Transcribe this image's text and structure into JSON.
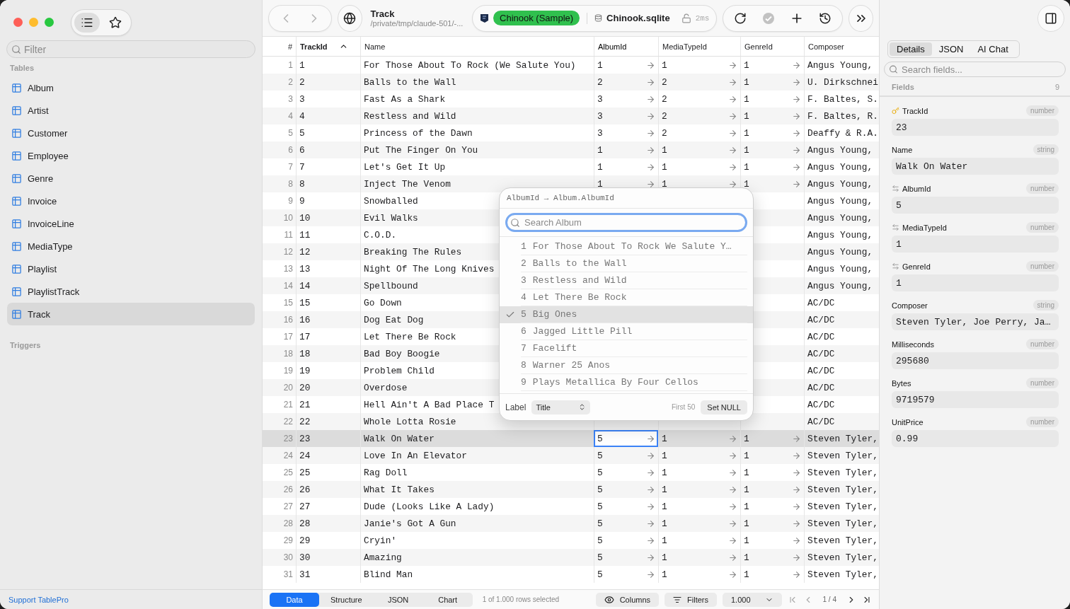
{
  "sidebar": {
    "filter": {
      "placeholder": "Filter"
    },
    "sections": [
      {
        "title": "Tables",
        "items": [
          {
            "label": "Album",
            "selected": false
          },
          {
            "label": "Artist",
            "selected": false
          },
          {
            "label": "Customer",
            "selected": false
          },
          {
            "label": "Employee",
            "selected": false
          },
          {
            "label": "Genre",
            "selected": false
          },
          {
            "label": "Invoice",
            "selected": false
          },
          {
            "label": "InvoiceLine",
            "selected": false
          },
          {
            "label": "MediaType",
            "selected": false
          },
          {
            "label": "Playlist",
            "selected": false
          },
          {
            "label": "PlaylistTrack",
            "selected": false
          },
          {
            "label": "Track",
            "selected": true
          }
        ]
      },
      {
        "title": "Triggers"
      }
    ],
    "footer_link": "Support TablePro",
    "view_toggle": [
      {
        "kind": "list",
        "selected": true
      },
      {
        "kind": "favorites",
        "selected": false
      }
    ]
  },
  "toolbar": {
    "title": "Track",
    "subtitle": "/private/tmp/claude-501/-...",
    "connection": {
      "name": "Chinook (Sample)",
      "color": "#30c04e",
      "database": "Chinook.sqlite",
      "latency": "2ms"
    }
  },
  "table": {
    "columns": [
      {
        "label": "#",
        "sorted": false,
        "foreign_key": false,
        "focused": false
      },
      {
        "label": "TrackId",
        "sorted": true,
        "foreign_key": false,
        "focused": false
      },
      {
        "label": "Name",
        "sorted": false,
        "foreign_key": false,
        "focused": false
      },
      {
        "label": "AlbumId",
        "sorted": false,
        "foreign_key": true,
        "focused": true
      },
      {
        "label": "MediaTypeId",
        "sorted": false,
        "foreign_key": true,
        "focused": false
      },
      {
        "label": "GenreId",
        "sorted": false,
        "foreign_key": true,
        "focused": false
      },
      {
        "label": "Composer",
        "sorted": false,
        "foreign_key": false,
        "focused": false
      }
    ],
    "rows": [
      {
        "cells": [
          "1",
          "1",
          "For Those About To Rock (We Salute You)",
          "1",
          "1",
          "1",
          "Angus Young,"
        ],
        "selected": false
      },
      {
        "cells": [
          "2",
          "2",
          "Balls to the Wall",
          "2",
          "2",
          "1",
          "U. Dirkschnei"
        ],
        "selected": false
      },
      {
        "cells": [
          "3",
          "3",
          "Fast As a Shark",
          "3",
          "2",
          "1",
          "F. Baltes, S."
        ],
        "selected": false
      },
      {
        "cells": [
          "4",
          "4",
          "Restless and Wild",
          "3",
          "2",
          "1",
          "F. Baltes, R."
        ],
        "selected": false
      },
      {
        "cells": [
          "5",
          "5",
          "Princess of the Dawn",
          "3",
          "2",
          "1",
          "Deaffy & R.A."
        ],
        "selected": false
      },
      {
        "cells": [
          "6",
          "6",
          "Put The Finger On You",
          "1",
          "1",
          "1",
          "Angus Young,"
        ],
        "selected": false
      },
      {
        "cells": [
          "7",
          "7",
          "Let's Get It Up",
          "1",
          "1",
          "1",
          "Angus Young,"
        ],
        "selected": false
      },
      {
        "cells": [
          "8",
          "8",
          "Inject The Venom",
          "1",
          "1",
          "1",
          "Angus Young,"
        ],
        "selected": false
      },
      {
        "cells": [
          "9",
          "9",
          "Snowballed",
          null,
          null,
          null,
          "Angus Young,"
        ],
        "selected": false
      },
      {
        "cells": [
          "10",
          "10",
          "Evil Walks",
          null,
          null,
          null,
          "Angus Young,"
        ],
        "selected": false
      },
      {
        "cells": [
          "11",
          "11",
          "C.O.D.",
          null,
          null,
          null,
          "Angus Young,"
        ],
        "selected": false
      },
      {
        "cells": [
          "12",
          "12",
          "Breaking The Rules",
          null,
          null,
          null,
          "Angus Young,"
        ],
        "selected": false
      },
      {
        "cells": [
          "13",
          "13",
          "Night Of The Long Knives",
          null,
          null,
          null,
          "Angus Young,"
        ],
        "selected": false
      },
      {
        "cells": [
          "14",
          "14",
          "Spellbound",
          null,
          null,
          null,
          "Angus Young,"
        ],
        "selected": false
      },
      {
        "cells": [
          "15",
          "15",
          "Go Down",
          null,
          null,
          null,
          "AC/DC"
        ],
        "selected": false
      },
      {
        "cells": [
          "16",
          "16",
          "Dog Eat Dog",
          null,
          null,
          null,
          "AC/DC"
        ],
        "selected": false
      },
      {
        "cells": [
          "17",
          "17",
          "Let There Be Rock",
          null,
          null,
          null,
          "AC/DC"
        ],
        "selected": false
      },
      {
        "cells": [
          "18",
          "18",
          "Bad Boy Boogie",
          null,
          null,
          null,
          "AC/DC"
        ],
        "selected": false
      },
      {
        "cells": [
          "19",
          "19",
          "Problem Child",
          null,
          null,
          null,
          "AC/DC"
        ],
        "selected": false
      },
      {
        "cells": [
          "20",
          "20",
          "Overdose",
          null,
          null,
          null,
          "AC/DC"
        ],
        "selected": false
      },
      {
        "cells": [
          "21",
          "21",
          "Hell Ain't A Bad Place T",
          null,
          null,
          null,
          "AC/DC"
        ],
        "selected": false
      },
      {
        "cells": [
          "22",
          "22",
          "Whole Lotta Rosie",
          null,
          null,
          null,
          "AC/DC"
        ],
        "selected": false
      },
      {
        "cells": [
          "23",
          "23",
          "Walk On Water",
          "5",
          "1",
          "1",
          "Steven Tyler,"
        ],
        "selected": true
      },
      {
        "cells": [
          "24",
          "24",
          "Love In An Elevator",
          "5",
          "1",
          "1",
          "Steven Tyler,"
        ],
        "selected": false
      },
      {
        "cells": [
          "25",
          "25",
          "Rag Doll",
          "5",
          "1",
          "1",
          "Steven Tyler,"
        ],
        "selected": false
      },
      {
        "cells": [
          "26",
          "26",
          "What It Takes",
          "5",
          "1",
          "1",
          "Steven Tyler,"
        ],
        "selected": false
      },
      {
        "cells": [
          "27",
          "27",
          "Dude (Looks Like A Lady)",
          "5",
          "1",
          "1",
          "Steven Tyler,"
        ],
        "selected": false
      },
      {
        "cells": [
          "28",
          "28",
          "Janie's Got A Gun",
          "5",
          "1",
          "1",
          "Steven Tyler,"
        ],
        "selected": false
      },
      {
        "cells": [
          "29",
          "29",
          "Cryin'",
          "5",
          "1",
          "1",
          "Steven Tyler,"
        ],
        "selected": false
      },
      {
        "cells": [
          "30",
          "30",
          "Amazing",
          "5",
          "1",
          "1",
          "Steven Tyler,"
        ],
        "selected": false
      },
      {
        "cells": [
          "31",
          "31",
          "Blind Man",
          "5",
          "1",
          "1",
          "Steven Tyler,"
        ],
        "selected": false
      }
    ]
  },
  "popover": {
    "title": "AlbumId → Album.AlbumId",
    "search": {
      "placeholder": "Search Album"
    },
    "options": [
      {
        "id": "1",
        "label": "For Those About To Rock We Salute Y…",
        "selected": false
      },
      {
        "id": "2",
        "label": "Balls to the Wall",
        "selected": false
      },
      {
        "id": "3",
        "label": "Restless and Wild",
        "selected": false
      },
      {
        "id": "4",
        "label": "Let There Be Rock",
        "selected": false
      },
      {
        "id": "5",
        "label": "Big Ones",
        "selected": true
      },
      {
        "id": "6",
        "label": "Jagged Little Pill",
        "selected": false
      },
      {
        "id": "7",
        "label": "Facelift",
        "selected": false
      },
      {
        "id": "8",
        "label": "Warner 25 Anos",
        "selected": false
      },
      {
        "id": "9",
        "label": "Plays Metallica By Four Cellos",
        "selected": false
      }
    ],
    "label_caption": "Label",
    "label_select": "Title",
    "limit_note": "First 50",
    "null_button": "Set NULL"
  },
  "bottom_bar": {
    "tabs": [
      {
        "label": "Data",
        "selected": true
      },
      {
        "label": "Structure",
        "selected": false
      },
      {
        "label": "JSON",
        "selected": false
      },
      {
        "label": "Chart",
        "selected": false
      }
    ],
    "status": "1 of 1.000 rows selected",
    "columns_button": "Columns",
    "filters_button": "Filters",
    "page_size": "1.000",
    "page": "1 / 4"
  },
  "inspector": {
    "tabs": [
      {
        "label": "Details",
        "selected": true
      },
      {
        "label": "JSON",
        "selected": false
      },
      {
        "label": "AI Chat",
        "selected": false
      }
    ],
    "search": {
      "placeholder": "Search fields..."
    },
    "fields_title": "Fields",
    "fields_count": "9",
    "fields": [
      {
        "name": "TrackId",
        "kind": "key",
        "type": "number",
        "value": "23"
      },
      {
        "name": "Name",
        "kind": "plain",
        "type": "string",
        "value": "Walk On Water"
      },
      {
        "name": "AlbumId",
        "kind": "link",
        "type": "number",
        "value": "5"
      },
      {
        "name": "MediaTypeId",
        "kind": "link",
        "type": "number",
        "value": "1"
      },
      {
        "name": "GenreId",
        "kind": "link",
        "type": "number",
        "value": "1"
      },
      {
        "name": "Composer",
        "kind": "plain",
        "type": "string",
        "value": "Steven Tyler, Joe Perry, Ja…"
      },
      {
        "name": "Milliseconds",
        "kind": "plain",
        "type": "number",
        "value": "295680"
      },
      {
        "name": "Bytes",
        "kind": "plain",
        "type": "number",
        "value": "9719579"
      },
      {
        "name": "UnitPrice",
        "kind": "plain",
        "type": "number",
        "value": "0.99"
      }
    ]
  }
}
